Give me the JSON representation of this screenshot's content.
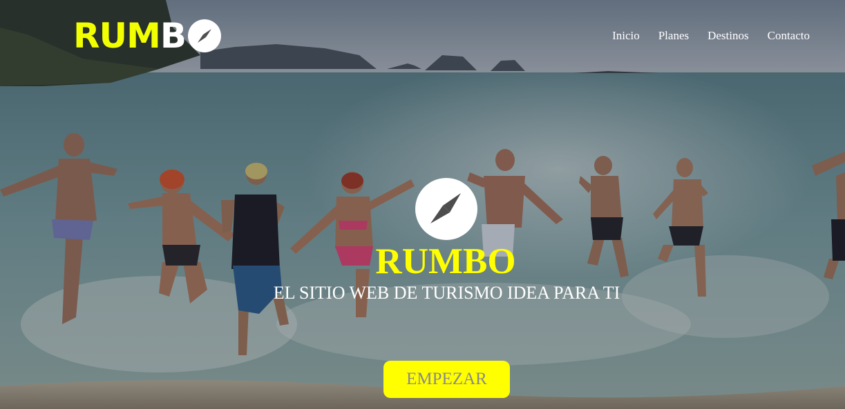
{
  "header": {
    "logo": {
      "accent": "RUM",
      "plain": "B"
    },
    "nav": [
      {
        "label": "Inicio"
      },
      {
        "label": "Planes"
      },
      {
        "label": "Destinos"
      },
      {
        "label": "Contacto"
      }
    ]
  },
  "hero": {
    "title": "RUMBO",
    "subtitle": "EL SITIO WEB DE TURISMO IDEA PARA TI",
    "button_label": "EMPEZAR",
    "background_icon": "beach-photo"
  },
  "colors": {
    "accent_yellow": "#ffff00",
    "logo_yellow": "#f2ff00",
    "nav_text": "#ffffff",
    "button_text": "#8a8a8a"
  },
  "icons": {
    "logo": "compass-icon",
    "center": "compass-icon"
  }
}
